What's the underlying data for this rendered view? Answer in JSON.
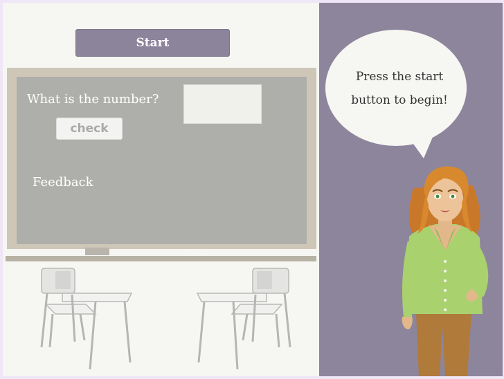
{
  "toolbar": {
    "start_label": "Start"
  },
  "board": {
    "question": "What is the number?",
    "check_label": "check",
    "answer_value": "",
    "feedback": "Feedback"
  },
  "speech": {
    "line1": "Press the start",
    "line2": "button to begin!"
  },
  "colors": {
    "accent": "#8c849b",
    "panel": "#8d859c",
    "board": "#aeaeab",
    "board_frame": "#cec7b8",
    "shirt": "#a9d16e",
    "hair": "#d8892e"
  }
}
